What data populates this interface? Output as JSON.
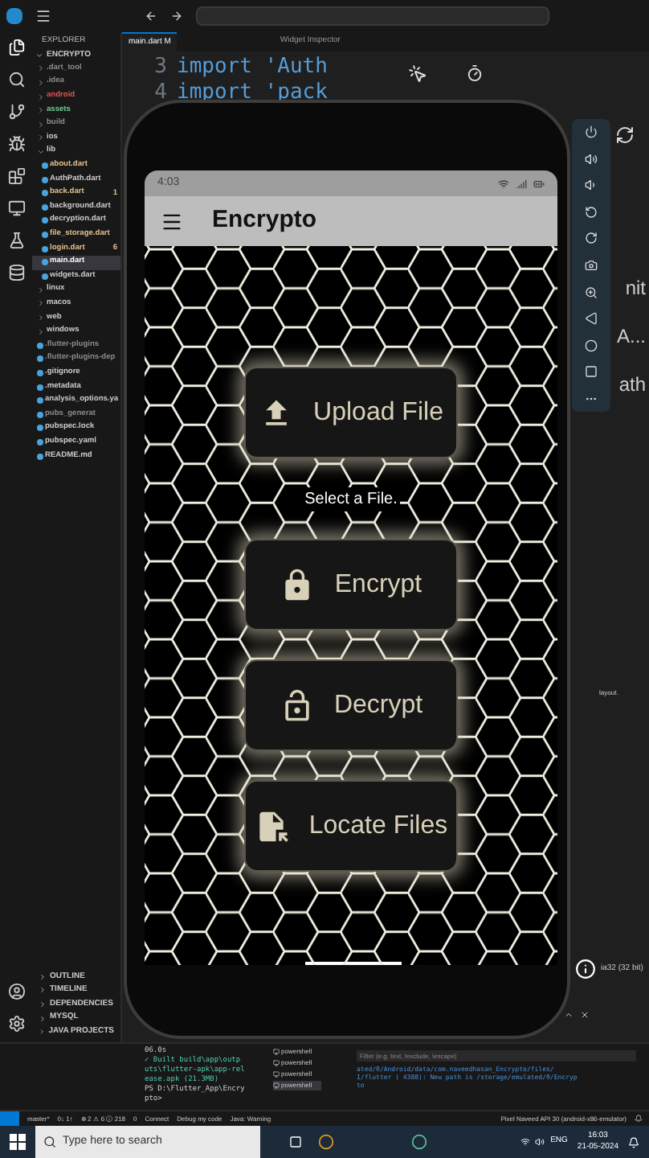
{
  "explorer": {
    "title": "EXPLORER",
    "root": "ENCRYPTO",
    "items": [
      {
        "label": ".dart_tool",
        "kind": "folder",
        "expanded": false,
        "color": "#8b8b8b"
      },
      {
        "label": ".idea",
        "kind": "folder",
        "expanded": false,
        "color": "#8b8b8b"
      },
      {
        "label": "android",
        "kind": "folder",
        "expanded": false,
        "color": "#e05252"
      },
      {
        "label": "assets",
        "kind": "folder",
        "expanded": false,
        "color": "#73c991"
      },
      {
        "label": "build",
        "kind": "folder",
        "expanded": false,
        "color": "#8b8b8b"
      },
      {
        "label": "ios",
        "kind": "folder",
        "expanded": false,
        "color": "#cccccc"
      },
      {
        "label": "lib",
        "kind": "folder",
        "expanded": true,
        "color": "#cccccc",
        "children": [
          {
            "label": "about.dart",
            "kind": "file",
            "color": "#e2c08d"
          },
          {
            "label": "AuthPath.dart",
            "kind": "file",
            "color": "#cccccc"
          },
          {
            "label": "back.dart",
            "kind": "file",
            "color": "#e2c08d",
            "badge": "1"
          },
          {
            "label": "background.dart",
            "kind": "file",
            "color": "#cccccc"
          },
          {
            "label": "decryption.dart",
            "kind": "file",
            "color": "#cccccc"
          },
          {
            "label": "file_storage.dart",
            "kind": "file",
            "color": "#e2c08d"
          },
          {
            "label": "login.dart",
            "kind": "file",
            "color": "#e2c08d",
            "badge": "6"
          },
          {
            "label": "main.dart",
            "kind": "file",
            "selected": true
          },
          {
            "label": "widgets.dart",
            "kind": "file",
            "color": "#cccccc"
          }
        ]
      },
      {
        "label": "linux",
        "kind": "folder",
        "expanded": false,
        "color": "#cccccc"
      },
      {
        "label": "macos",
        "kind": "folder",
        "expanded": false,
        "color": "#cccccc"
      },
      {
        "label": "web",
        "kind": "folder",
        "expanded": false,
        "color": "#cccccc"
      },
      {
        "label": "windows",
        "kind": "folder",
        "expanded": false,
        "color": "#cccccc"
      },
      {
        "label": ".flutter-plugins",
        "kind": "file",
        "color": "#8b8b8b"
      },
      {
        "label": ".flutter-plugins-dep",
        "kind": "file",
        "color": "#8b8b8b"
      },
      {
        "label": ".gitignore",
        "kind": "file",
        "color": "#cccccc"
      },
      {
        "label": ".metadata",
        "kind": "file",
        "color": "#cccccc"
      },
      {
        "label": "analysis_options.ya",
        "kind": "file",
        "color": "#cccccc"
      },
      {
        "label": "pubs_generat",
        "kind": "file",
        "color": "#8b8b8b"
      },
      {
        "label": "pubspec.lock",
        "kind": "file",
        "color": "#cccccc"
      },
      {
        "label": "pubspec.yaml",
        "kind": "file",
        "color": "#cccccc"
      },
      {
        "label": "README.md",
        "kind": "file",
        "color": "#cccccc"
      }
    ],
    "sections": [
      "OUTLINE",
      "TIMELINE",
      "DEPENDENCIES",
      "MYSQL",
      "JAVA PROJECTS"
    ]
  },
  "editor": {
    "tabs": [
      {
        "label": "main.dart M",
        "selected": true
      },
      {
        "label": "Widget Inspector",
        "selected": false
      }
    ],
    "lines": [
      {
        "number": "3",
        "code": "import 'Auth"
      },
      {
        "number": "4",
        "code": "import 'pack"
      }
    ],
    "fragments": [
      "nit",
      "A...",
      "ath"
    ],
    "side_note": "layout.",
    "device_arch": "ia32 (32 bit)"
  },
  "phone": {
    "time": "4:03",
    "title": "Encrypto",
    "hint": "Select a File.",
    "buttons": [
      {
        "label": "Upload File",
        "kind": "upload"
      },
      {
        "label": "Encrypt",
        "kind": "lock"
      },
      {
        "label": "Decrypt",
        "kind": "unlock"
      },
      {
        "label": "Locate Files",
        "kind": "locate"
      }
    ]
  },
  "terminal": {
    "lines": [
      "06.0s",
      "✓  Built build\\app\\outp",
      "uts\\flutter-apk\\app-rel",
      "ease.apk (21.3MB)",
      "PS D:\\Flutter_App\\Encry",
      "pto>"
    ],
    "tabs": [
      {
        "label": "powershell",
        "selected": false
      },
      {
        "label": "powershell",
        "selected": false
      },
      {
        "label": "powershell",
        "selected": false
      },
      {
        "label": "powershell",
        "selected": true
      }
    ]
  },
  "debug_console": {
    "placeholder": "Filter (e.g. text, !exclude, \\escape)",
    "lines": [
      "ated/0/Android/data/com.naveedhasan_Encrypto/files/",
      "I/flutter ( 4388): New path is /storage/emulated/0/Encryp",
      "to"
    ]
  },
  "status_bar": {
    "branch": "master*",
    "sync": "0↓ 1↑",
    "problems": "⊗ 2 ⚠ 6 ⓘ 218",
    "ports": "0",
    "connect": "Connect",
    "debug": "Debug my code",
    "java": "Java: Warning",
    "device": "Pixel Naveed API 30 (android-x86-emulator)"
  },
  "taskbar": {
    "search_placeholder": "Type here to search",
    "language": "ENG",
    "time": "16:03",
    "date": "21-05-2024"
  }
}
